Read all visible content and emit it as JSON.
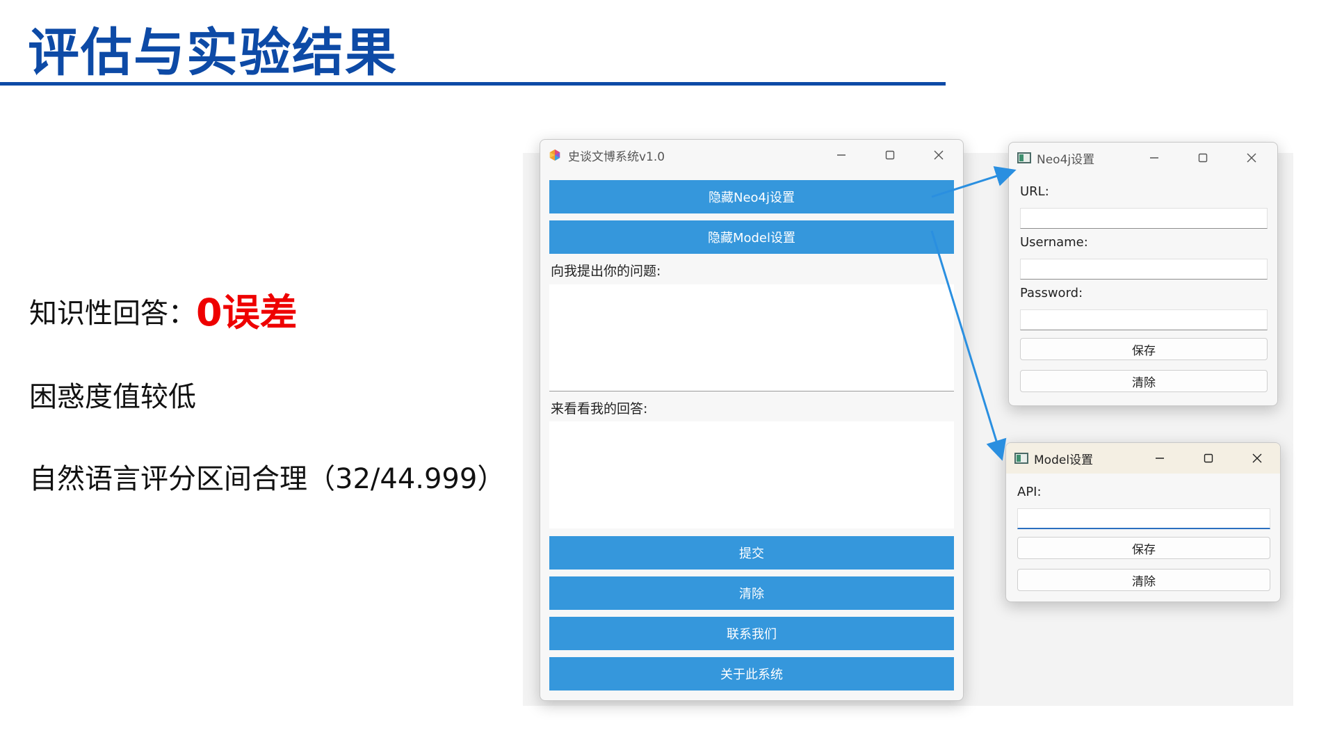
{
  "slide": {
    "title": "评估与实验结果",
    "bullets": [
      {
        "text": "知识性回答：",
        "highlight": "0误差"
      },
      {
        "text": "困惑度值较低"
      },
      {
        "text": "自然语言评分区间合理（32/44.999）"
      }
    ]
  },
  "main_window": {
    "title": "史谈文博系统v1.0",
    "buttons": {
      "hide_neo4j": "隐藏Neo4j设置",
      "hide_model": "隐藏Model设置",
      "submit": "提交",
      "clear": "清除",
      "contact": "联系我们",
      "about": "关于此系统"
    },
    "question_label": "向我提出你的问题:",
    "question_value": "",
    "answer_label": "来看看我的回答:",
    "answer_value": ""
  },
  "neo4j_window": {
    "title": "Neo4j设置",
    "url_label": "URL:",
    "url_value": "",
    "username_label": "Username:",
    "username_value": "",
    "password_label": "Password:",
    "password_value": "",
    "save_label": "保存",
    "clear_label": "清除"
  },
  "model_window": {
    "title": "Model设置",
    "api_label": "API:",
    "api_value": "",
    "save_label": "保存",
    "clear_label": "清除"
  },
  "colors": {
    "title_blue": "#0d4aa6",
    "highlight_red": "#ee0000",
    "button_blue": "#3597dc",
    "arrow_blue": "#2a8fe0"
  }
}
